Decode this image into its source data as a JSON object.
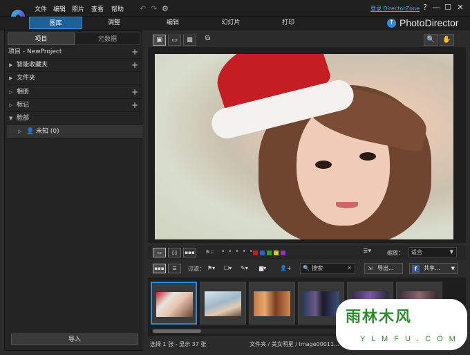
{
  "app": {
    "brand": "PhotoDirector"
  },
  "menu": [
    "文件",
    "编辑",
    "照片",
    "查看",
    "帮助"
  ],
  "account": {
    "signin": "登录 DirectorZone"
  },
  "window_buttons": [
    "?",
    "—",
    "☐",
    "✕"
  ],
  "modules": {
    "library": "图库",
    "adjust": "调整",
    "edit": "编辑",
    "slideshow": "幻灯片",
    "print": "打印"
  },
  "left_panel": {
    "tabs": {
      "project": "项目",
      "metadata": "元数据"
    },
    "project_row": "项目 - NewProject",
    "smart_collections": "智能收藏夹",
    "folders": "文件夹",
    "albums": "相册",
    "tags": "标记",
    "faces": "脸部",
    "unknown_face": "未知 (0)",
    "import_button": "导入"
  },
  "viewer_controls": {
    "zoom_label": "缩放：",
    "zoom_value": "适合",
    "rating_dots": "• • • • •",
    "color_labels": [
      "#c01f1f",
      "#2a5fd0",
      "#2aa02a",
      "#d8c52a",
      "#8a3ab8"
    ]
  },
  "filter_bar": {
    "filter_label": "过滤：",
    "search_placeholder": "搜索",
    "export_label": "导出...",
    "share_label": "共享..."
  },
  "status": {
    "selection": "选择 1 张 - 显示 37 张",
    "path": "文件夹 / 美女明星 / Image00011..."
  },
  "watermark": {
    "main": "雨林木风",
    "sub": "Y L M F U . C O M"
  }
}
